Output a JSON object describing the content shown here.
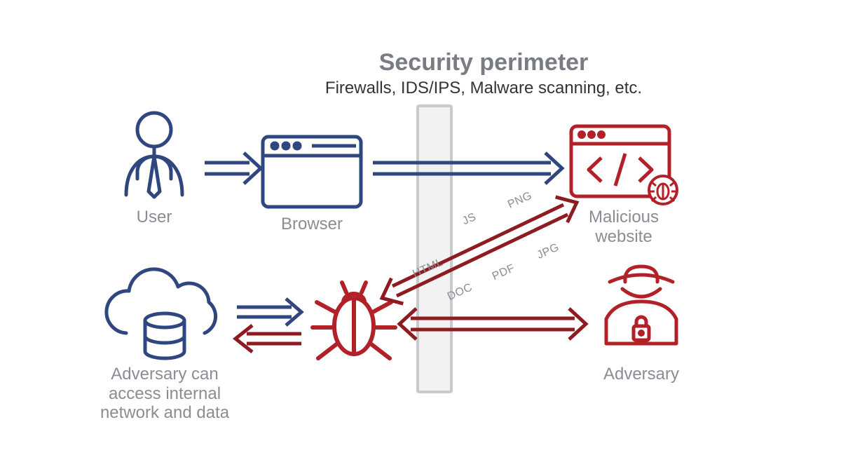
{
  "title": "Security perimeter",
  "subtitle": "Firewalls, IDS/IPS, Malware scanning, etc.",
  "nodes": {
    "user": "User",
    "browser": "Browser",
    "cloud": "Adversary can\naccess internal\nnetwork and data",
    "malicious_site": "Malicious\nwebsite",
    "adversary": "Adversary"
  },
  "file_types": [
    "HTML",
    "JS",
    "PNG",
    "DOC",
    "PDF",
    "JPG"
  ],
  "colors": {
    "blue": "#2f477e",
    "red": "#b22028",
    "grey": "#c9cacd",
    "label": "#8b8d94"
  }
}
